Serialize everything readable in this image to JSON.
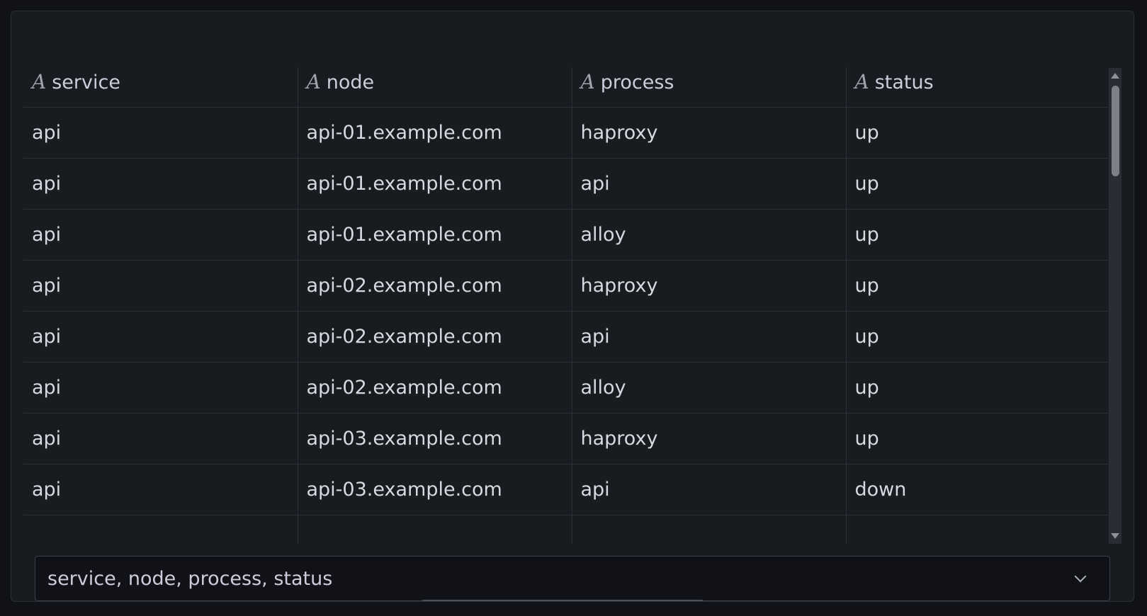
{
  "table": {
    "columns": [
      {
        "icon": "A",
        "label": "service"
      },
      {
        "icon": "A",
        "label": "node"
      },
      {
        "icon": "A",
        "label": "process"
      },
      {
        "icon": "A",
        "label": "status"
      }
    ],
    "rows": [
      [
        "api",
        "api-01.example.com",
        "haproxy",
        "up"
      ],
      [
        "api",
        "api-01.example.com",
        "api",
        "up"
      ],
      [
        "api",
        "api-01.example.com",
        "alloy",
        "up"
      ],
      [
        "api",
        "api-02.example.com",
        "haproxy",
        "up"
      ],
      [
        "api",
        "api-02.example.com",
        "api",
        "up"
      ],
      [
        "api",
        "api-02.example.com",
        "alloy",
        "up"
      ],
      [
        "api",
        "api-03.example.com",
        "haproxy",
        "up"
      ],
      [
        "api",
        "api-03.example.com",
        "api",
        "down"
      ]
    ]
  },
  "field_select": {
    "value": "service, node, process, status"
  },
  "icons": {
    "column_type": "string-type-icon",
    "select_toggle": "chevron-down-icon"
  },
  "colors": {
    "background": "#111217",
    "panel": "#181b1f",
    "border": "#2c2f36",
    "text": "#ccccdc"
  }
}
